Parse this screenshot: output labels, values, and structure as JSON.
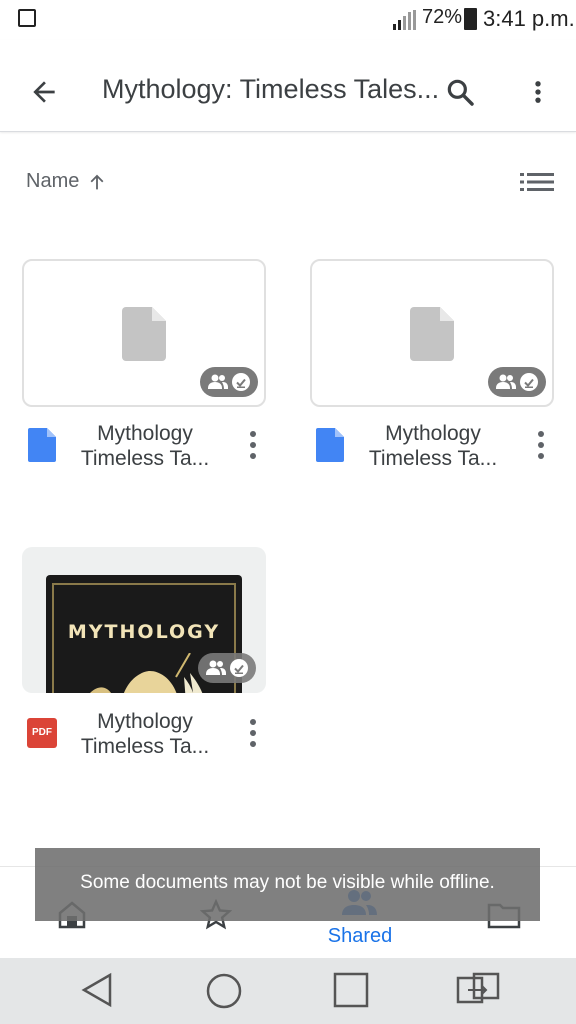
{
  "status_bar": {
    "battery_percent": "72%",
    "time": "3:41 p.m.",
    "icons": [
      "gallery-icon",
      "signal-icon",
      "battery-icon"
    ]
  },
  "app_bar": {
    "title": "Mythology: Timeless Tales...",
    "icons": [
      "back-arrow-icon",
      "search-icon",
      "more-vert-icon"
    ]
  },
  "sort": {
    "label": "Name",
    "direction": "ascending",
    "view_toggle_icon": "list-view-icon"
  },
  "files": [
    {
      "name_line1": "Mythology",
      "name_line2": "Timeless Ta...",
      "type": "google-doc",
      "shared": true,
      "offline": true
    },
    {
      "name_line1": "Mythology",
      "name_line2": "Timeless Ta...",
      "type": "google-doc",
      "shared": true,
      "offline": true
    },
    {
      "name_line1": "Mythology",
      "name_line2": "Timeless Ta...",
      "type": "pdf",
      "type_label": "PDF",
      "cover_title": "MYTHOLOGY",
      "shared": true,
      "offline": true
    }
  ],
  "toast": {
    "message": "Some documents may not be visible while offline."
  },
  "bottom_nav": {
    "active_label": "Shared",
    "items": [
      "home-icon",
      "starred-icon",
      "shared-icon",
      "files-folder-icon"
    ]
  },
  "colors": {
    "accent": "#1a73e8",
    "doc_blue": "#4285f4",
    "pdf_red": "#db4437",
    "badge_gray": "#7a7a7a"
  }
}
